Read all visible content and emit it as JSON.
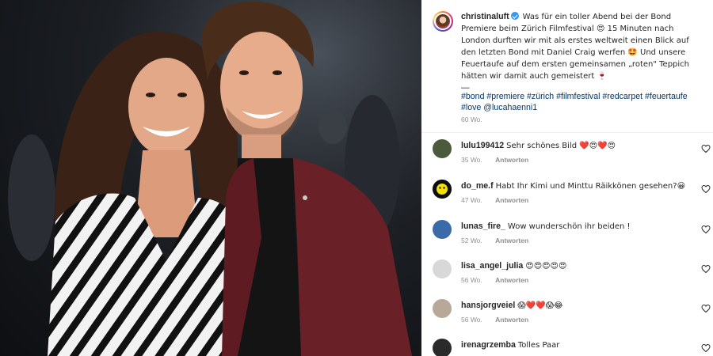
{
  "post": {
    "author": "christinaluft",
    "caption_text": "Was für ein toller Abend bei der Bond Premiere beim Zürich Filmfestival 😍 15 Minuten nach London durften wir mit als erstes weltweit einen Blick auf den letzten Bond mit Daniel Craig werfen 🤩 Und unsere Feuertaufe auf dem ersten gemeinsamen „roten\" Teppich hätten wir damit auch gemeistert 🍷",
    "separator": "—",
    "hashtags": "#bond #premiere #zürich #filmfestival #redcarpet #feuertaufe #love @lucahaenni1",
    "age": "60 Wo."
  },
  "comments": [
    {
      "user": "lulu199412",
      "text": "Sehr schönes Bild ❤️😍❤️😍",
      "age": "35 Wo.",
      "reply": "Antworten",
      "avatar_color": "#4a5a3a"
    },
    {
      "user": "do_me.f",
      "text": "Habt Ihr Kimi und Minttu Räikkönen gesehen?😀",
      "age": "47 Wo.",
      "reply": "Antworten",
      "avatar_color": "#e8d400"
    },
    {
      "user": "lunas_fire_",
      "text": "Wow wunderschön ihr beiden !",
      "age": "52 Wo.",
      "reply": "Antworten",
      "avatar_color": "#3a6aa8"
    },
    {
      "user": "lisa_angel_julia",
      "text": "😍😍😍😍😍",
      "age": "56 Wo.",
      "reply": "Antworten",
      "avatar_color": "#d8d8d8"
    },
    {
      "user": "hansjorgveiel",
      "text": "😱❤️❤️😱😂",
      "age": "56 Wo.",
      "reply": "Antworten",
      "avatar_color": "#b8a89a"
    },
    {
      "user": "irenagrzemba",
      "text": "Tolles Paar",
      "age": "56 Wo.",
      "reply": "Antworten",
      "avatar_color": "#2a2a2a"
    }
  ],
  "icons": {
    "heart": "heart-outline-icon",
    "verified": "verified-badge-icon"
  },
  "colors": {
    "link": "#00376b",
    "muted": "#8e8e8e",
    "verified": "#3897f0"
  }
}
